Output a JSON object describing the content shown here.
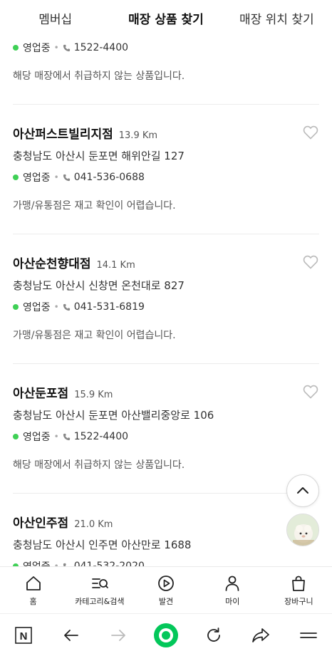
{
  "top_tabs": [
    {
      "label": "멤버십",
      "active": false
    },
    {
      "label": "매장 상품 찾기",
      "active": true
    },
    {
      "label": "매장 위치 찾기",
      "active": false
    }
  ],
  "partial_store": {
    "status": "영업중",
    "phone": "1522-4400",
    "note": "해당 매장에서 취급하지 않는 상품입니다."
  },
  "stores": [
    {
      "name": "아산퍼스트빌리지점",
      "distance": "13.9 Km",
      "address": "충청남도 아산시 둔포면 해위안길 127",
      "status": "영업중",
      "phone": "041-536-0688",
      "note": "가맹/유통점은 재고 확인이 어렵습니다."
    },
    {
      "name": "아산순천향대점",
      "distance": "14.1 Km",
      "address": "충청남도 아산시 신창면 온천대로 827",
      "status": "영업중",
      "phone": "041-531-6819",
      "note": "가맹/유통점은 재고 확인이 어렵습니다."
    },
    {
      "name": "아산둔포점",
      "distance": "15.9 Km",
      "address": "충청남도 아산시 둔포면 아산밸리중앙로 106",
      "status": "영업중",
      "phone": "1522-4400",
      "note": "해당 매장에서 취급하지 않는 상품입니다."
    },
    {
      "name": "아산인주점",
      "distance": "21.0 Km",
      "address": "충청남도 아산시 인주면 아산만로 1688",
      "status": "영업중",
      "phone": "041-532-2020",
      "note": ""
    }
  ],
  "bottom_nav": [
    {
      "label": "홈",
      "icon": "home-icon"
    },
    {
      "label": "카테고리&검색",
      "icon": "category-search-icon"
    },
    {
      "label": "발견",
      "icon": "discover-icon"
    },
    {
      "label": "마이",
      "icon": "user-icon"
    },
    {
      "label": "장바구니",
      "icon": "shopping-bag-icon"
    }
  ],
  "browser_bar": {
    "logo_letter": "N",
    "icons": [
      "naver-logo-icon",
      "back-arrow-icon",
      "forward-arrow-icon",
      "home-dot-icon",
      "refresh-icon",
      "share-icon",
      "menu-icon"
    ]
  },
  "colors": {
    "status_green": "#3fd056",
    "accent_green": "#03c75a"
  }
}
